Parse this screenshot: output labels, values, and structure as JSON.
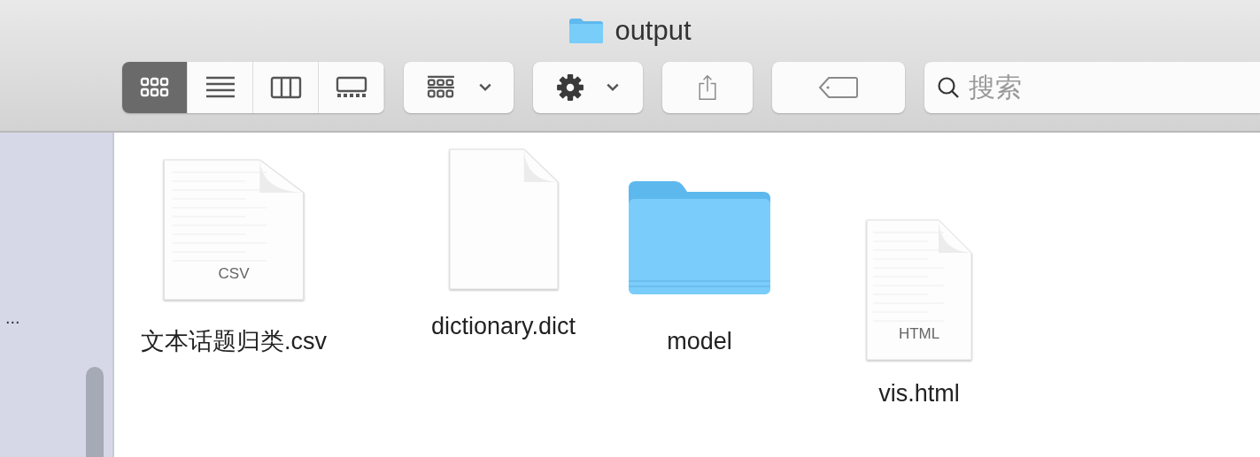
{
  "window": {
    "title": "output"
  },
  "toolbar": {
    "view_modes": [
      {
        "kind": "icons",
        "selected": true
      },
      {
        "kind": "list",
        "selected": false
      },
      {
        "kind": "columns",
        "selected": false
      },
      {
        "kind": "gallery",
        "selected": false
      }
    ],
    "search": {
      "placeholder": "搜索"
    }
  },
  "sidebar": {
    "overflow_text": "..."
  },
  "files": [
    {
      "kind": "document",
      "badge": "CSV",
      "name": "文本话题归类.csv"
    },
    {
      "kind": "document",
      "name": "dictionary.dict"
    },
    {
      "kind": "folder",
      "name": "model"
    },
    {
      "kind": "document",
      "badge": "HTML",
      "name": "vis.html"
    }
  ]
}
